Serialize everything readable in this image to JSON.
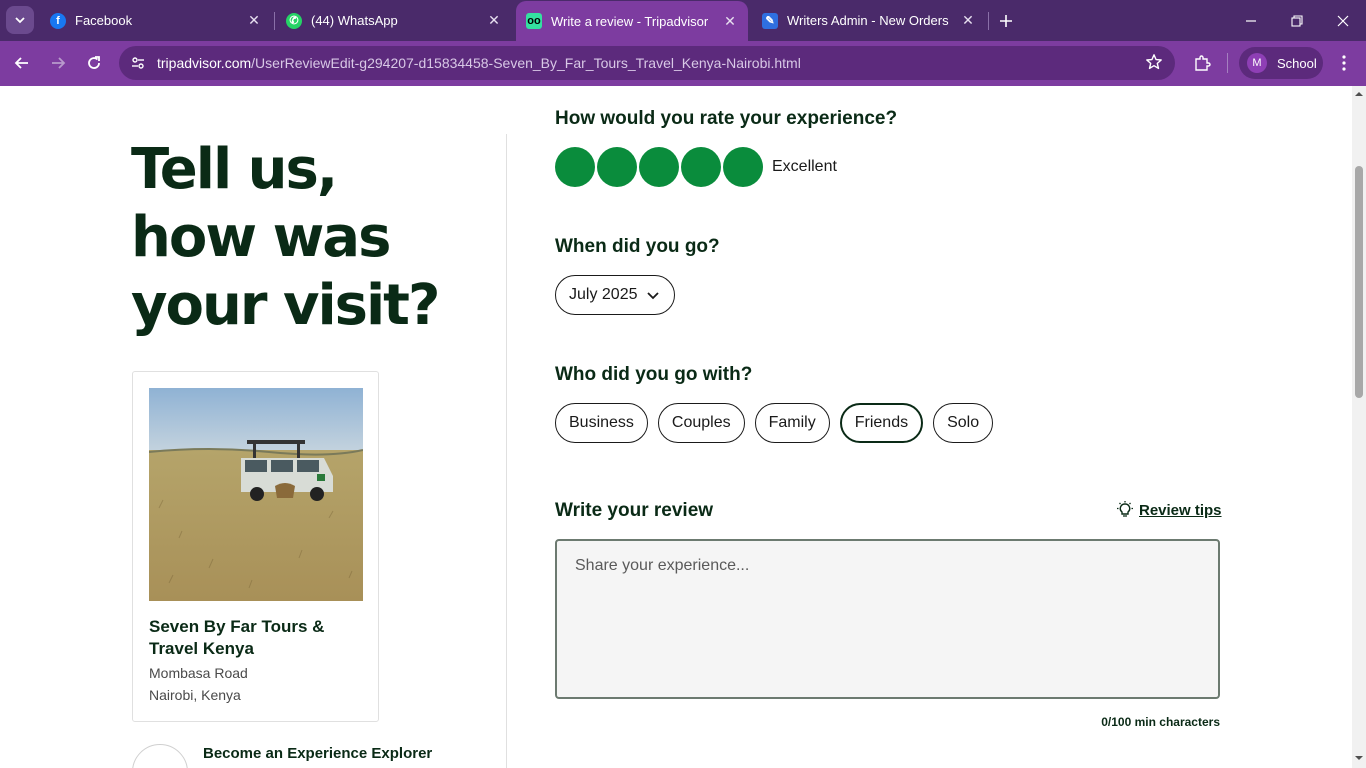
{
  "browser": {
    "tabs": [
      {
        "title": "Facebook",
        "icon": "facebook-icon",
        "color": "#1877f2",
        "active": false
      },
      {
        "title": "(44) WhatsApp",
        "icon": "whatsapp-icon",
        "color": "#25d366",
        "active": false
      },
      {
        "title": "Write a review - Tripadvisor",
        "icon": "tripadvisor-icon",
        "color": "#34e0a1",
        "active": true
      },
      {
        "title": "Writers Admin - New Orders",
        "icon": "writers-admin-icon",
        "color": "#2f6fe0",
        "active": false
      }
    ],
    "url_host": "tripadvisor.com",
    "url_path": "/UserReviewEdit-g294207-d15834458-Seven_By_Far_Tours_Travel_Kenya-Nairobi.html",
    "profile_initial": "M",
    "profile_name": "School",
    "colors": {
      "tabbar": "#4a2a6a",
      "toolbar": "#7d3ca0"
    }
  },
  "page": {
    "hero": "Tell us, how was your visit?",
    "business": {
      "name": "Seven By Far Tours & Travel Kenya",
      "address_line1": "Mombasa Road",
      "address_line2": "Nairobi, Kenya"
    },
    "explorer_text": "Become an Experience Explorer",
    "rating": {
      "question": "How would you rate your experience?",
      "value": 5,
      "max": 5,
      "label": "Excellent",
      "color": "#0a8c3c"
    },
    "when": {
      "question": "When did you go?",
      "selected": "July 2025"
    },
    "who": {
      "question": "Who did you go with?",
      "options": [
        "Business",
        "Couples",
        "Family",
        "Friends",
        "Solo"
      ],
      "selected": "Friends"
    },
    "review": {
      "heading": "Write your review",
      "tips_label": "Review tips",
      "placeholder": "Share your experience...",
      "value": "",
      "counter": "0/100 min characters"
    }
  }
}
